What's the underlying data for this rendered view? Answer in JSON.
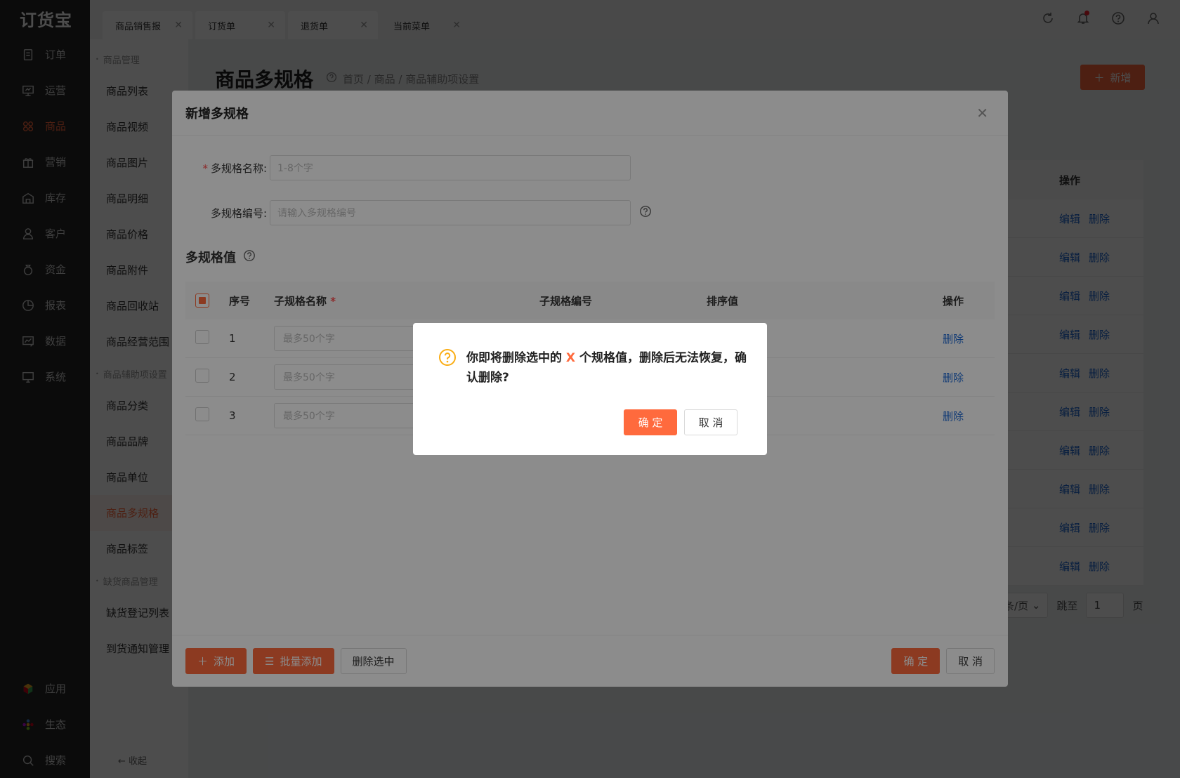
{
  "app": {
    "logo": "订货宝",
    "nav": [
      {
        "label": "订单",
        "icon": "order-icon",
        "active": false
      },
      {
        "label": "运营",
        "icon": "presentation-icon",
        "active": false
      },
      {
        "label": "商品",
        "icon": "grid-icon",
        "active": true
      },
      {
        "label": "营销",
        "icon": "gift-icon",
        "active": false
      },
      {
        "label": "库存",
        "icon": "warehouse-icon",
        "active": false
      },
      {
        "label": "客户",
        "icon": "user-icon",
        "active": false
      },
      {
        "label": "资金",
        "icon": "money-bag-icon",
        "active": false
      },
      {
        "label": "报表",
        "icon": "pie-chart-icon",
        "active": false
      },
      {
        "label": "数据",
        "icon": "data-icon",
        "active": false
      },
      {
        "label": "系统",
        "icon": "monitor-icon",
        "active": false
      }
    ],
    "nav_bottom": [
      {
        "label": "应用",
        "icon": "apps-icon"
      },
      {
        "label": "生态",
        "icon": "ecology-icon"
      },
      {
        "label": "搜索",
        "icon": "search-icon"
      }
    ]
  },
  "submenu": {
    "group1": "商品管理",
    "items1": [
      "商品列表",
      "商品视频",
      "商品图片",
      "商品明细",
      "商品价格",
      "商品附件",
      "商品回收站",
      "商品经营范围"
    ],
    "group2": "商品辅助项设置",
    "items2": [
      "商品分类",
      "商品品牌",
      "商品单位",
      "商品多规格",
      "商品标签"
    ],
    "active": "商品多规格",
    "group3": "缺货商品管理",
    "items3": [
      "缺货登记列表",
      "到货通知管理"
    ],
    "collapse": "← 收起"
  },
  "tabs": [
    {
      "label": "商品销售报",
      "active": false
    },
    {
      "label": "订货单",
      "active": false
    },
    {
      "label": "退货单",
      "active": false
    },
    {
      "label": "当前菜单",
      "active": true
    }
  ],
  "page": {
    "title": "商品多规格",
    "breadcrumb": "首页 / 商品 / 商品辅助项设置",
    "new_button": "新增",
    "ops_header": "操作",
    "row_edit": "编辑",
    "row_delete": "删除",
    "pager_size": "条/页",
    "jump_label": "跳至",
    "jump_value": "1",
    "page_unit": "页"
  },
  "modal": {
    "title": "新增多规格",
    "name_label": "多规格名称:",
    "name_placeholder": "1-8个字",
    "code_label": "多规格编号:",
    "code_placeholder": "请输入多规格编号",
    "section_title": "多规格值",
    "columns": {
      "no": "序号",
      "name": "子规格名称",
      "code": "子规格编号",
      "sort": "排序值",
      "op": "操作"
    },
    "rows": [
      {
        "no": "1",
        "placeholder": "最多50个字",
        "op": "删除"
      },
      {
        "no": "2",
        "placeholder": "最多50个字",
        "op": "删除"
      },
      {
        "no": "3",
        "placeholder": "最多50个字",
        "op": "删除"
      }
    ],
    "add_button": "添加",
    "batch_add_button": "批量添加",
    "delete_selected_button": "删除选中",
    "ok_button": "确 定",
    "cancel_button": "取 消"
  },
  "confirm": {
    "msg_prefix": "你即将删除选中的",
    "msg_count": "X",
    "msg_suffix": "个规格值，删除后无法恢复，确认删除?",
    "ok": "确 定",
    "cancel": "取 消"
  },
  "colors": {
    "accent": "#ff6a3d",
    "link": "#1f6bd6",
    "nav_bg": "#262626"
  }
}
